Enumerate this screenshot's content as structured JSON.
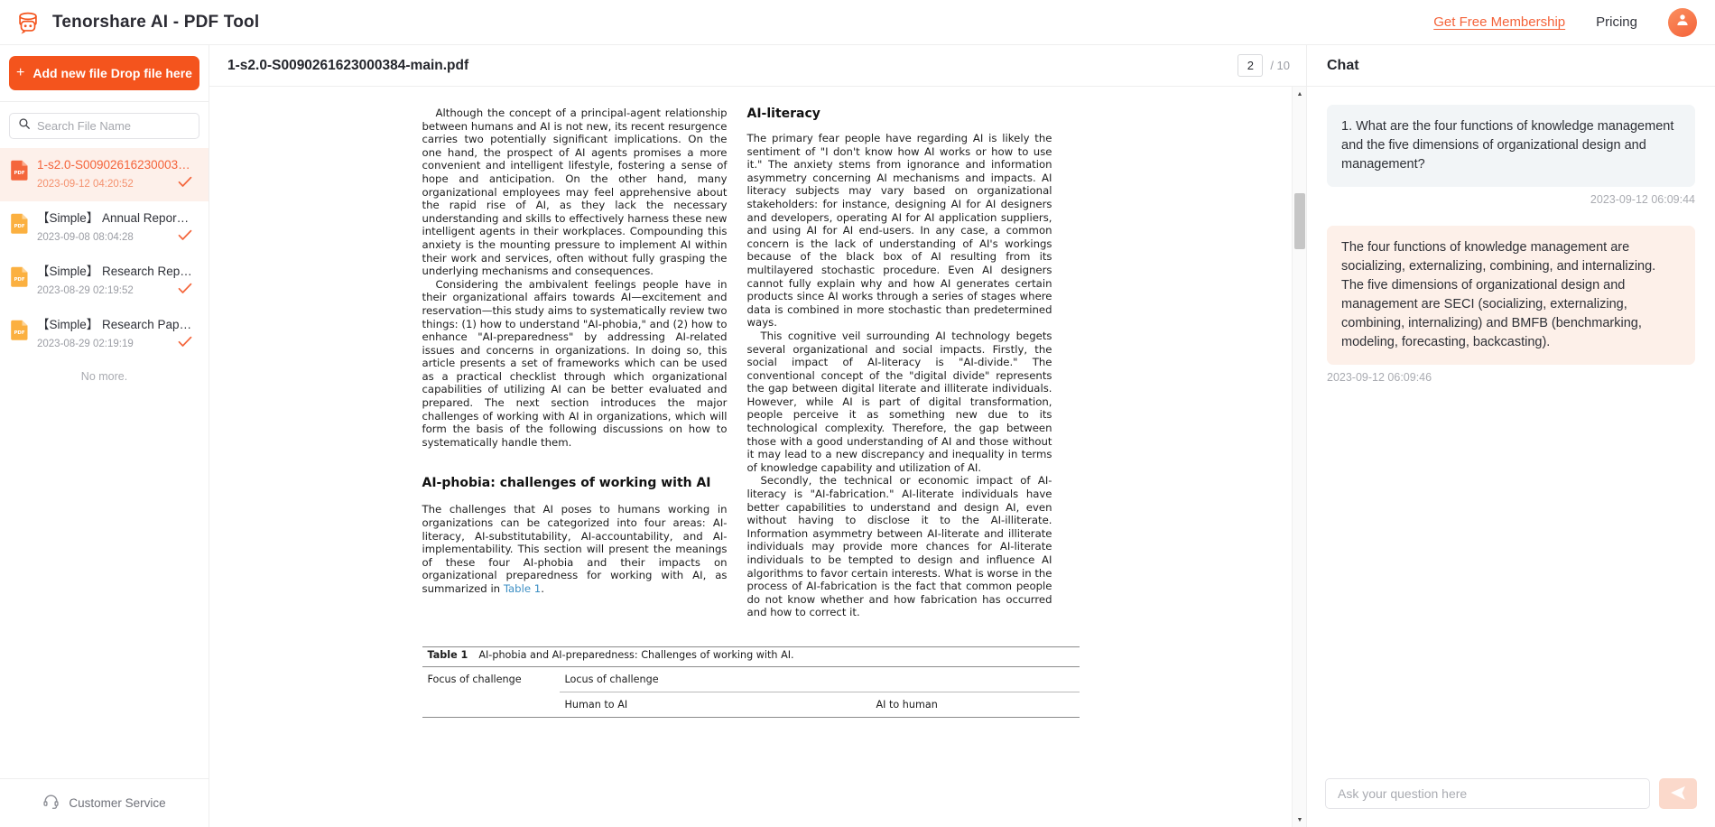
{
  "header": {
    "brand_title": "Tenorshare AI - PDF Tool",
    "logo_icon": "pdf-chat-logo-icon",
    "membership_link": "Get Free Membership",
    "pricing_link": "Pricing",
    "avatar_icon": "user-avatar-icon",
    "accent_color": "#f4633a"
  },
  "sidebar": {
    "add_button": {
      "label": "Add new file Drop file here",
      "icon": "plus-icon"
    },
    "search": {
      "placeholder": "Search File Name",
      "value": "",
      "icon": "search-icon"
    },
    "files": [
      {
        "name": "1-s2.0-S00902616230003…",
        "date": "2023-09-12 04:20:52",
        "active": true,
        "status_icon": "check-icon"
      },
      {
        "name": "【Simple】 Annual Repor…",
        "date": "2023-09-08 08:04:28",
        "active": false,
        "status_icon": "check-icon"
      },
      {
        "name": "【Simple】 Research Rep…",
        "date": "2023-08-29 02:19:52",
        "active": false,
        "status_icon": "check-icon"
      },
      {
        "name": "【Simple】 Research Pap…",
        "date": "2023-08-29 02:19:19",
        "active": false,
        "status_icon": "check-icon"
      }
    ],
    "end_of_list": "No more.",
    "customer_service": {
      "label": "Customer Service",
      "icon": "headset-icon"
    }
  },
  "viewer": {
    "doc_title": "1-s2.0-S0090261623000384-main.pdf",
    "current_page": "2",
    "total_pages": "/ 10",
    "scroll_up_icon": "caret-up-icon",
    "scroll_down_icon": "caret-down-icon",
    "page": {
      "left_column": {
        "paragraphs": [
          "Although the concept of a principal-agent relationship between humans and AI is not new, its recent resurgence carries two potentially significant implications. On the one hand, the prospect of AI agents promises a more convenient and intelligent lifestyle, fostering a sense of hope and anticipation. On the other hand, many organizational employees may feel apprehensive about the rapid rise of AI, as they lack the necessary understanding and skills to effectively harness these new intelligent agents in their workplaces. Compounding this anxiety is the mounting pressure to implement AI within their work and services, often without fully grasping the underlying mechanisms and consequences.",
          "Considering the ambivalent feelings people have in their organizational affairs towards AI—excitement and reservation—this study aims to systematically review two things: (1) how to understand \"AI-phobia,\" and (2) how to enhance \"AI-preparedness\" by addressing AI-related issues and concerns in organizations. In doing so, this article presents a set of frameworks which can be used as a practical checklist through which organizational capabilities of utilizing AI can be better evaluated and prepared. The next section introduces the major challenges of working with AI in organizations, which will form the basis of the following discussions on how to systematically handle them."
        ],
        "heading": "AI-phobia: challenges of working with AI",
        "after_heading_part1": "The challenges that AI poses to humans working in organizations can be categorized into four areas: AI-literacy, AI-substitutability, AI-accountability, and AI-implementability. This section will present the meanings of these four AI-phobia and their impacts on organizational preparedness for working with AI, as summarized in ",
        "after_heading_link": "Table 1",
        "after_heading_part2": "."
      },
      "right_column": {
        "heading": "AI-literacy",
        "paragraphs": [
          "The primary fear people have regarding AI is likely the sentiment of \"I don't know how AI works or how to use it.\" The anxiety stems from ignorance and information asymmetry concerning AI mechanisms and impacts. AI literacy subjects may vary based on organizational stakeholders: for instance, designing AI for AI designers and developers, operating AI for AI application suppliers, and using AI for AI end-users. In any case, a common concern is the lack of understanding of AI's workings because of the black box of AI resulting from its multilayered stochastic procedure. Even AI designers cannot fully explain why and how AI generates certain products since AI works through a series of stages where data is combined in more stochastic than predetermined ways.",
          "This cognitive veil surrounding AI technology begets several organizational and social impacts. Firstly, the social impact of AI-literacy is \"AI-divide.\" The conventional concept of the \"digital divide\" represents the gap between digital literate and illiterate individuals. However, while AI is part of digital transformation, people perceive it as something new due to its technological complexity. Therefore, the gap between those with a good understanding of AI and those without it may lead to a new discrepancy and inequality in terms of knowledge capability and utilization of AI.",
          "Secondly, the technical or economic impact of AI-literacy is \"AI-fabrication.\" AI-literate individuals have better capabilities to understand and design AI, even without having to disclose it to the AI-illiterate. Information asymmetry between AI-literate and illiterate individuals may provide more chances for AI-literate individuals to be tempted to design and influence AI algorithms to favor certain interests. What is worse in the process of AI-fabrication is the fact that common people do not know whether and how fabrication has occurred and how to correct it."
        ]
      },
      "table": {
        "label": "Table 1",
        "caption": "AI-phobia and AI-preparedness: Challenges of working with AI.",
        "header_row_1": [
          "Focus of challenge",
          "Locus of challenge"
        ],
        "header_row_2": [
          "",
          "Human to AI",
          "AI to human"
        ]
      }
    }
  },
  "chat": {
    "title": "Chat",
    "messages": [
      {
        "role": "question",
        "text": "1. What are the four functions of knowledge management and the five dimensions of organizational design and management?",
        "time": "2023-09-12 06:09:44"
      },
      {
        "role": "answer",
        "text": "The four functions of knowledge management are socializing, externalizing, combining, and internalizing. The five dimensions of organizational design and management are SECI (socializing, externalizing, combining, internalizing) and BMFB (benchmarking, modeling, forecasting, backcasting).",
        "time": "2023-09-12 06:09:46"
      }
    ],
    "input": {
      "placeholder": "Ask your question here",
      "value": ""
    },
    "send_button": {
      "icon": "send-plane-icon"
    }
  }
}
